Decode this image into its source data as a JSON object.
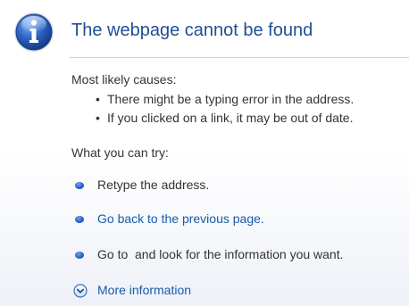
{
  "header": {
    "title": "The webpage cannot be found"
  },
  "causes": {
    "heading": "Most likely causes:",
    "items": [
      "There might be a typing error in the address.",
      "If you clicked on a link, it may be out of date."
    ]
  },
  "try": {
    "heading": "What you can try:",
    "items": [
      {
        "text": "Retype the address.",
        "kind": "text"
      },
      {
        "text": "Go back to the previous page.",
        "kind": "link"
      },
      {
        "text": "Go to  and look for the information you want.",
        "kind": "text"
      }
    ]
  },
  "more_info": {
    "label": "More information"
  },
  "icons": {
    "header": "info-icon",
    "bullet": "blue-bullet-icon",
    "expand": "chevron-down-circle-icon"
  },
  "colors": {
    "title": "#1f4e96",
    "link": "#1a5aa8",
    "text": "#333333",
    "accent": "#2a63c8"
  }
}
